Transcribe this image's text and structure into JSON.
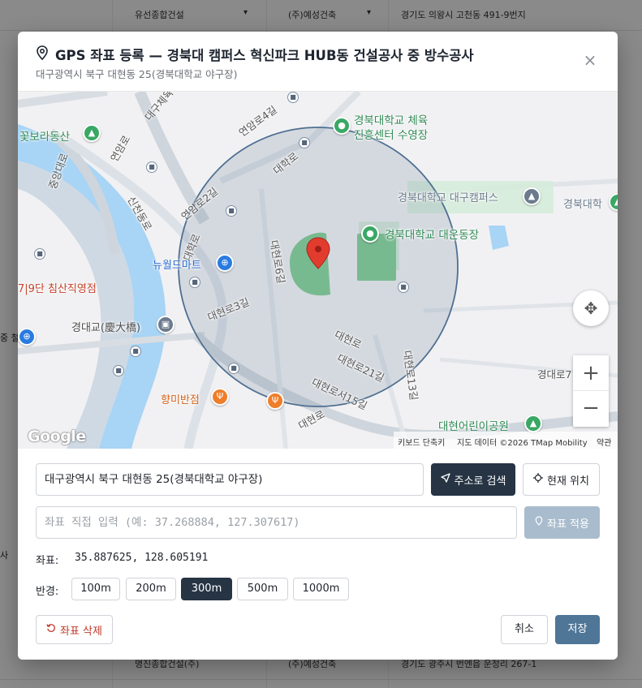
{
  "background": {
    "top_row": {
      "company": "유선종합건설",
      "subcontractor": "(주)예성건축",
      "address": "경기도 의왕시 고천동 491-9번지"
    },
    "bottom_row": {
      "company": "명진종합건설(주)",
      "subcontractor": "(주)예성건축",
      "address": "경기도 광주시 번엔읍 운정리 267-1"
    },
    "left_fragments": [
      "중 철",
      "사"
    ]
  },
  "modal": {
    "title": "GPS 좌표 등록 — 경북대 캠퍼스 혁신파크 HUB동 건설공사 중 방수공사",
    "subtitle": "대구광역시 북구 대현동 25(경북대학교 야구장)",
    "close_label": "×",
    "map": {
      "labels": {
        "kkot": "꽃보라동산",
        "yeonamro": "연암로",
        "daeguchedae": "대구체육",
        "yeonamro4": "연암로4길",
        "sincheon": "신천동로",
        "jungangdae": "중앙대로",
        "knu_pool_1": "경북대학교 체육",
        "knu_pool_2": "진흥센터 수영장",
        "daehakro_top": "대학로",
        "yeonamro2": "연암로2길",
        "knu_campus": "경북대학교 대구캠퍼스",
        "knu_right": "경북대학",
        "daehakro_left": "대학로",
        "knu_stadium": "경북대학교 대운동장",
        "newworld": "뉴월드마트",
        "daehyeon6": "대현로6길",
        "chimsan": "7|9단 침산직영점",
        "daehyeon3": "대현로3길",
        "gyeongdae": "경대교(慶大橋)",
        "jung": "중 철",
        "daehyeon13": "대현로13길",
        "daehyeon21": "대현로21길",
        "daehyeonro": "대현로",
        "hyangmi": "향미반점",
        "daehyeonseo15": "대현로서15길",
        "daehyeonro_bottom": "대현로",
        "daehyeon_kinder": "대현어린이공원",
        "gyeongdaero": "경대로7"
      },
      "google": "Google",
      "attribution": {
        "keyboard": "키보드 단축키",
        "data": "지도 데이터 ©2026 TMap Mobility",
        "terms": "약관"
      },
      "zoom_in": "+",
      "zoom_out": "−"
    },
    "address_input_value": "대구광역시 북구 대현동 25(경북대학교 야구장)",
    "search_button": "주소로 검색",
    "current_location_button": "현재 위치",
    "coord_input_placeholder": "좌표 직접 입력 (예: 37.268884, 127.307617)",
    "apply_button": "좌표 적용",
    "coord_label": "좌표:",
    "coord_value": "35.887625, 128.605191",
    "radius_label": "반경:",
    "radius_options": [
      "100m",
      "200m",
      "300m",
      "500m",
      "1000m"
    ],
    "radius_selected": "300m",
    "delete_button": "좌표 삭제",
    "cancel_button": "취소",
    "save_button": "저장"
  }
}
